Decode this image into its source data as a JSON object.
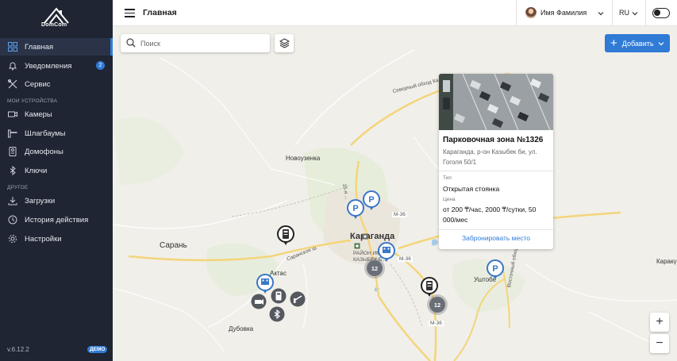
{
  "app": {
    "logo_text": "DomCom",
    "version": "v.6.12.2",
    "demo_badge": "ДЕМО"
  },
  "sidebar": {
    "items": [
      {
        "label": "Главная",
        "icon": "grid-icon",
        "active": true
      },
      {
        "label": "Уведомления",
        "icon": "bell-icon",
        "badge": "2"
      },
      {
        "label": "Сервис",
        "icon": "tools-icon"
      }
    ],
    "section_devices": "МОИ УСТРОЙСТВА",
    "devices": [
      {
        "label": "Камеры",
        "icon": "camera-icon"
      },
      {
        "label": "Шлагбаумы",
        "icon": "barrier-icon"
      },
      {
        "label": "Домофоны",
        "icon": "intercom-icon"
      },
      {
        "label": "Ключи",
        "icon": "bluetooth-key-icon"
      }
    ],
    "section_other": "ДРУГОЕ",
    "other": [
      {
        "label": "Загрузки",
        "icon": "download-icon"
      },
      {
        "label": "История действия",
        "icon": "history-icon"
      },
      {
        "label": "Настройки",
        "icon": "settings-icon"
      }
    ]
  },
  "header": {
    "title": "Главная",
    "user_name": "Имя Фамилия",
    "language": "RU"
  },
  "map": {
    "search_placeholder": "Поиск",
    "add_button": "Добавить",
    "zoom_in": "+",
    "zoom_out": "−",
    "labels": {
      "karaganda": "Караганда",
      "saran": "Сарань",
      "novouzenka": "Новоузенка",
      "aktas": "Актас",
      "dubovka": "Дубовка",
      "ushtobe": "Уштобе",
      "karaku": "Каракү",
      "northern_bypass": "Северный обход Ка",
      "saran_road": "Саранское ш.",
      "road_m36_a": "М-36",
      "road_m36_b": "М-36",
      "road_m36_c": "М-36",
      "road_15": "15-я ...",
      "district": "РАЙОН ИМ. КАЗЫБЕК Б...",
      "vostochny": "Восточный обход"
    },
    "clusters": [
      "12",
      "12"
    ]
  },
  "popup": {
    "title": "Парковочная зона №1326",
    "address": "Караганда, р-он Казыбек би, ул. Гоголя 50/1",
    "type_label": "Тип",
    "type_value": "Открытая стоянка",
    "price_label": "Цена",
    "price_value": "от 200 ₸/час, 2000 ₸/сутки, 50 000/мес",
    "action": "Забронировать место"
  },
  "colors": {
    "sidebar_bg": "#1f2533",
    "accent": "#2f7bd6",
    "map_bg": "#f1efe9",
    "cluster": "#6a6e76"
  }
}
